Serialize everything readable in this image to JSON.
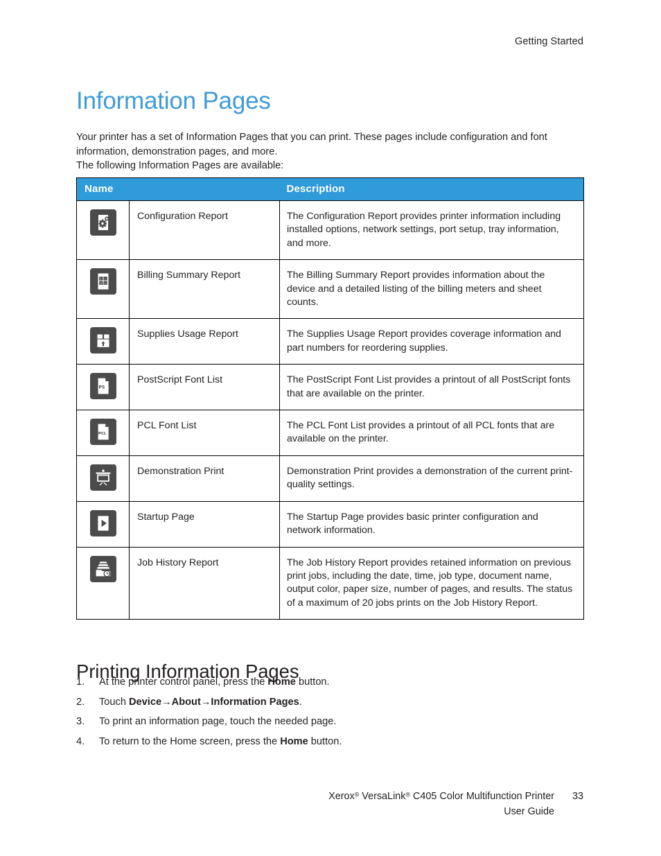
{
  "header": {
    "running_head": "Getting Started"
  },
  "title": "Information Pages",
  "intro": {
    "paragraph1": "Your printer has a set of Information Pages that you can print. These pages include configuration and font information, demonstration pages, and more.",
    "paragraph2": "The following Information Pages are available:"
  },
  "table": {
    "columns": [
      "Name",
      "Description"
    ],
    "rows": [
      {
        "icon": "configuration-report-icon",
        "name": "Configuration Report",
        "description": "The Configuration Report provides printer information including installed options, network settings, port setup, tray information, and more."
      },
      {
        "icon": "billing-summary-report-icon",
        "name": "Billing Summary Report",
        "description": "The Billing Summary Report provides information about the device and a detailed listing of the billing meters and sheet counts."
      },
      {
        "icon": "supplies-usage-report-icon",
        "name": "Supplies Usage Report",
        "description": "The Supplies Usage Report provides coverage information and part numbers for reordering supplies."
      },
      {
        "icon": "postscript-font-list-icon",
        "name": "PostScript Font List",
        "description": "The PostScript Font List provides a printout of all PostScript fonts that are available on the printer."
      },
      {
        "icon": "pcl-font-list-icon",
        "name": "PCL Font List",
        "description": "The PCL Font List provides a printout of all PCL fonts that are available on the printer."
      },
      {
        "icon": "demonstration-print-icon",
        "name": "Demonstration Print",
        "description": "Demonstration Print provides a demonstration of the current print-quality settings."
      },
      {
        "icon": "startup-page-icon",
        "name": "Startup Page",
        "description": "The Startup Page provides basic printer configuration and network information."
      },
      {
        "icon": "job-history-report-icon",
        "name": "Job History Report",
        "description": "The Job History Report provides retained information on previous print jobs, including the date, time, job type, document name, output color, paper size, number of pages, and results. The status of a maximum of 20 jobs prints on the Job History Report."
      }
    ]
  },
  "section": {
    "heading": "Printing Information Pages",
    "steps": [
      {
        "number": "1.",
        "parts": [
          {
            "text": "At the printer control panel, press the ",
            "bold": false
          },
          {
            "text": "Home",
            "bold": true
          },
          {
            "text": " button.",
            "bold": false
          }
        ]
      },
      {
        "number": "2.",
        "parts": [
          {
            "text": "Touch ",
            "bold": false
          },
          {
            "text": "Device",
            "bold": true
          },
          {
            "text": "→",
            "bold": true
          },
          {
            "text": "About",
            "bold": true
          },
          {
            "text": "→",
            "bold": true
          },
          {
            "text": "Information Pages",
            "bold": true
          },
          {
            "text": ".",
            "bold": false
          }
        ]
      },
      {
        "number": "3.",
        "parts": [
          {
            "text": "To print an information page, touch the needed page.",
            "bold": false
          }
        ]
      },
      {
        "number": "4.",
        "parts": [
          {
            "text": "To return to the Home screen, press the ",
            "bold": false
          },
          {
            "text": "Home",
            "bold": true
          },
          {
            "text": " button.",
            "bold": false
          }
        ]
      }
    ]
  },
  "footer": {
    "product_line_1_before": "Xerox",
    "product_line_1_mid": " VersaLink",
    "product_line_1_after": " C405 Color Multifunction Printer",
    "registered_mark": "®",
    "product_line_2": "User Guide",
    "page_number": "33"
  },
  "colors": {
    "title_blue": "#3f9bd6",
    "table_header_blue": "#2f9bd9",
    "icon_tile": "#4b4b4b",
    "text": "#231f20",
    "border": "#000000"
  }
}
